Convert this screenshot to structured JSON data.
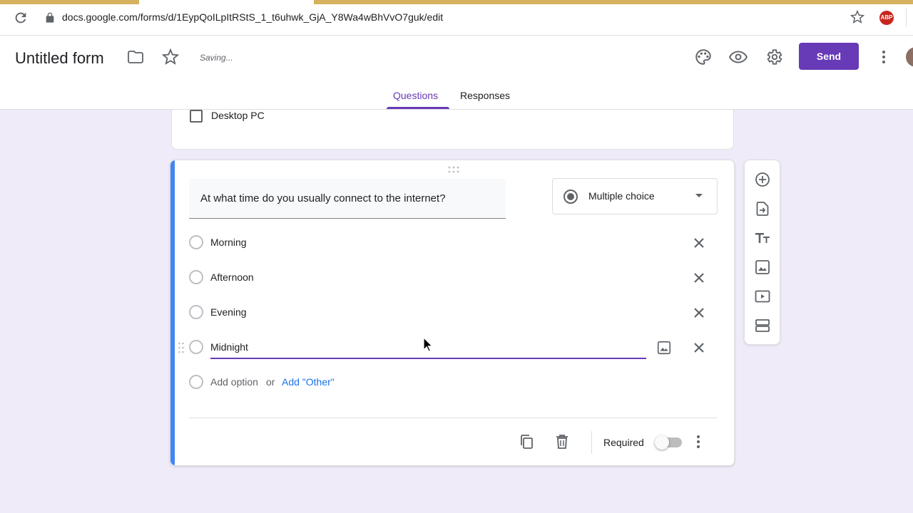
{
  "browser": {
    "url": "docs.google.com/forms/d/1EypQoILpItRStS_1_t6uhwk_GjA_Y8Wa4wBhVvO7guk/edit",
    "extension_badge": "ABP"
  },
  "header": {
    "form_title": "Untitled form",
    "save_status": "Saving...",
    "send_label": "Send",
    "accent_color": "#673ab7"
  },
  "tabs": [
    {
      "label": "Questions",
      "active": true
    },
    {
      "label": "Responses",
      "active": false
    }
  ],
  "previous_question": {
    "last_option": "Desktop PC"
  },
  "question": {
    "title": "At what time do you usually connect to the internet?",
    "type": "Multiple choice",
    "options": [
      "Morning",
      "Afternoon",
      "Evening",
      "Midnight"
    ],
    "editing_option_index": 3,
    "add_option_label": "Add option",
    "or_label": "or",
    "add_other_label": "Add \"Other\"",
    "required_label": "Required",
    "required": false
  },
  "icons": {
    "toolbar": [
      "add-question-icon",
      "import-questions-icon",
      "add-title-icon",
      "add-image-icon",
      "add-video-icon",
      "add-section-icon"
    ],
    "header": [
      "palette-icon",
      "preview-icon",
      "settings-icon",
      "more-vert-icon"
    ]
  }
}
